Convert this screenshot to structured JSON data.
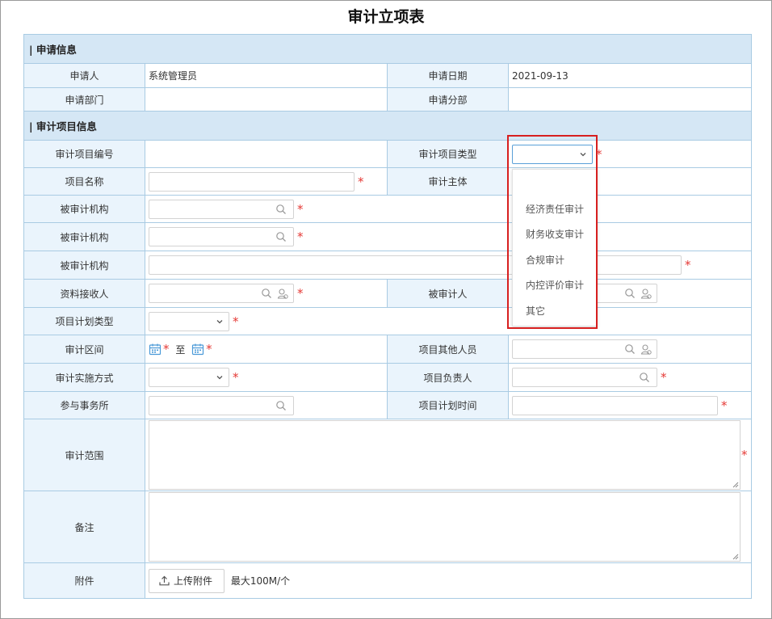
{
  "page": {
    "title": "审计立项表"
  },
  "sections": {
    "apply_info": "| 申请信息",
    "project_info": "| 审计项目信息"
  },
  "labels": {
    "applicant": "申请人",
    "apply_date": "申请日期",
    "apply_dept": "申请部门",
    "apply_branch": "申请分部",
    "project_no": "审计项目编号",
    "project_type": "审计项目类型",
    "project_name": "项目名称",
    "audit_subject": "审计主体",
    "audited_org_1": "被审计机构",
    "audited_org_2": "被审计机构",
    "audited_org_3": "被审计机构",
    "material_receiver": "资料接收人",
    "audited_person": "被审计人",
    "plan_type": "项目计划类型",
    "audit_period": "审计区间",
    "other_members": "项目其他人员",
    "impl_method": "审计实施方式",
    "project_leader": "项目负责人",
    "firm": "参与事务所",
    "plan_time": "项目计划时间",
    "scope": "审计范围",
    "remark": "备注",
    "attachment": "附件"
  },
  "values": {
    "applicant": "系统管理员",
    "apply_date": "2021-09-13",
    "apply_dept": "",
    "apply_branch": ""
  },
  "period_separator": "至",
  "required_mark": "*",
  "upload": {
    "button": "上传附件",
    "hint": "最大100M/个"
  },
  "dropdown": {
    "options": [
      "经济责任审计",
      "财务收支审计",
      "合规审计",
      "内控评价审计",
      "其它"
    ]
  },
  "colors": {
    "section_bg": "#d5e7f5",
    "label_bg": "#eaf4fc",
    "border": "#a9cbe3",
    "required": "#e53935",
    "highlight": "#d71f1f"
  }
}
